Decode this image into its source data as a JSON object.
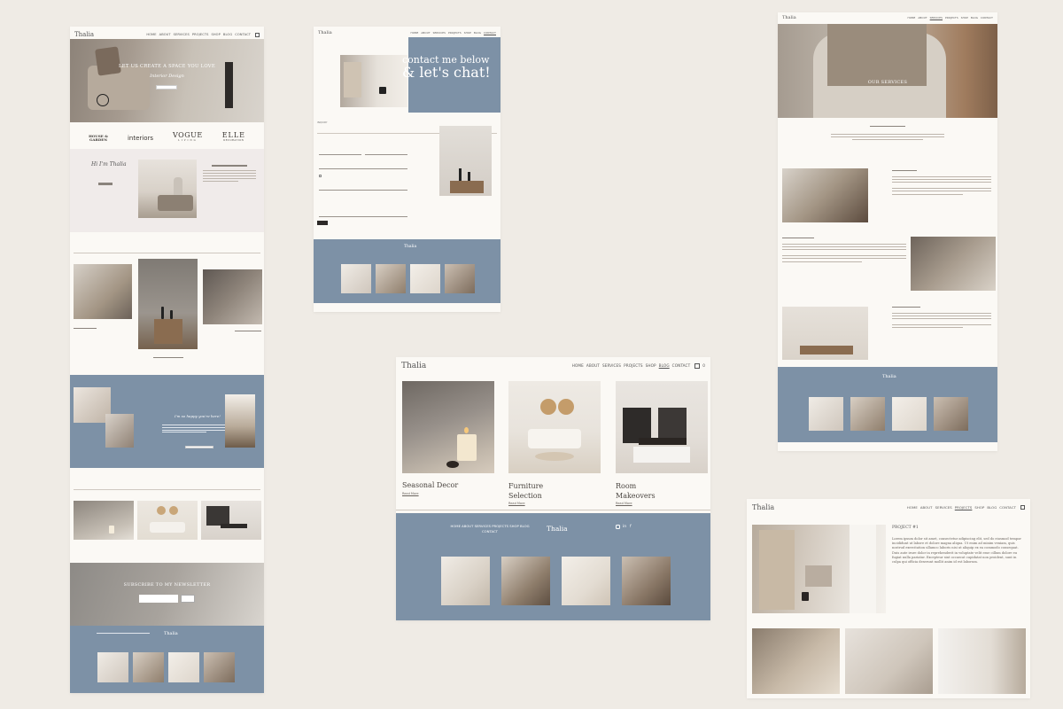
{
  "brand": {
    "logo": "Thalia"
  },
  "nav": {
    "items": [
      "HOME",
      "ABOUT",
      "SERVICES",
      "PROJECTS",
      "SHOP",
      "BLOG",
      "CONTACT"
    ],
    "cart_count": "0"
  },
  "home": {
    "hero_title": "LET US CREATE A SPACE YOU LOVE",
    "hero_script": "Interior Design",
    "press_logos": [
      "HOUSE & GARDEN",
      "interiors",
      "VOGUE",
      "ELLE"
    ],
    "vogue_sub": "LIVING",
    "elle_sub": "DECORATION",
    "about_script": "Hi I'm Thalia",
    "newsletter_title": "SUBSCRIBE TO MY NEWSLETTER",
    "happy_script": "I'm so happy you're here!"
  },
  "contact": {
    "headline_line1": "contact me below",
    "headline_line2": "& let's chat!",
    "form_heading": "INQUIRY"
  },
  "services": {
    "hero_title": "OUR SERVICES"
  },
  "blog": {
    "cards": [
      {
        "title": "Seasonal Decor",
        "link": "Read More"
      },
      {
        "title_line1": "Furniture",
        "title_line2": "Selection",
        "link": "Read More"
      },
      {
        "title_line1": "Room",
        "title_line2": "Makeovers",
        "link": "Read More"
      }
    ],
    "footer_links_line1": "HOME ABOUT SERVICES PROJECTS SHOP BLOG",
    "footer_links_line2": "CONTACT",
    "footer_logo": "Thalia",
    "social_icons": [
      "instagram-icon",
      "linkedin-icon",
      "facebook-icon"
    ]
  },
  "project": {
    "heading": "PROJECT #1",
    "body": "Lorem ipsum dolor sit amet, consectetur adipiscing elit, sed do eiusmod tempor incididunt ut labore et dolore magna aliqua. Ut enim ad minim veniam, quis nostrud exercitation ullamco laboris nisi ut aliquip ex ea commodo consequat. Duis aute irure dolor in reprehenderit in voluptate velit esse cillum dolore eu fugiat nulla pariatur. Excepteur sint occaecat cupidatat non proident, sunt in culpa qui officia deserunt mollit anim id est laborum."
  },
  "colors": {
    "blue": "#7d91a6",
    "cream": "#fbf9f5",
    "background": "#efebe5",
    "blush": "#f0ebea"
  }
}
